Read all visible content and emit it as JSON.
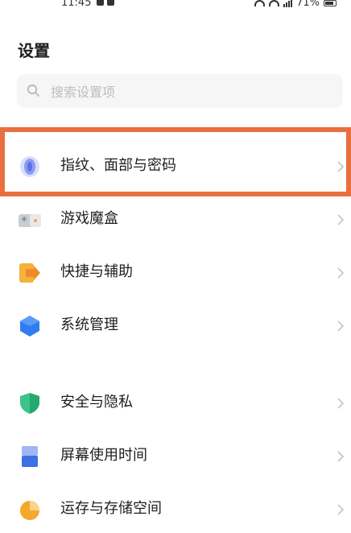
{
  "status_bar": {
    "time": "11:45",
    "battery_percent": "71%"
  },
  "header": {
    "title": "设置"
  },
  "search": {
    "placeholder": "搜索设置项",
    "value": ""
  },
  "menu": {
    "items": [
      {
        "label": "指纹、面部与密码",
        "icon": "fingerprint-icon"
      },
      {
        "label": "游戏魔盒",
        "icon": "game-box-icon"
      },
      {
        "label": "快捷与辅助",
        "icon": "shortcut-icon"
      },
      {
        "label": "系统管理",
        "icon": "system-hexagon-icon"
      },
      {
        "label": "安全与隐私",
        "icon": "shield-icon"
      },
      {
        "label": "屏幕使用时间",
        "icon": "screen-time-icon"
      },
      {
        "label": "运存与存储空间",
        "icon": "storage-pie-icon"
      }
    ]
  },
  "colors": {
    "highlight": "#e8703e",
    "fingerprint": "#7b8ff0",
    "shortcut": "#f5a13a",
    "system": "#2f7df0",
    "shield": "#3cc38a",
    "screen_time": "#4b78e6",
    "storage": "#f4a82c"
  }
}
